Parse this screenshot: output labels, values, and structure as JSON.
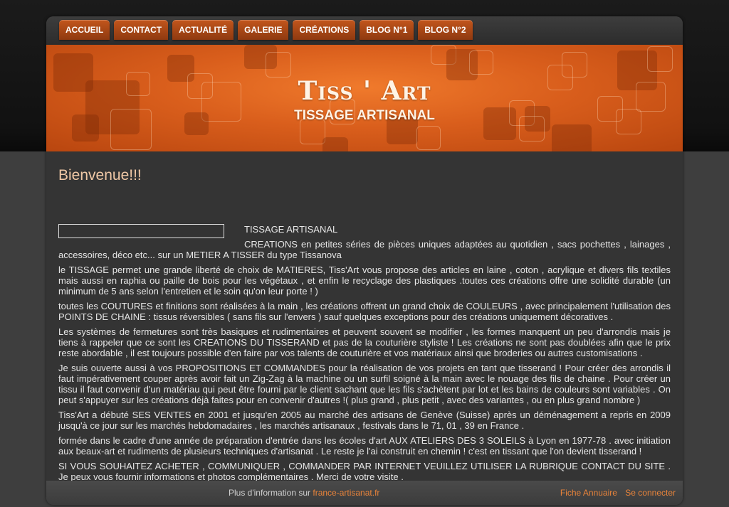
{
  "nav": {
    "items": [
      "ACCUEIL",
      "CONTACT",
      "ACTUALITÉ",
      "GALERIE",
      "CRÉATIONS",
      "BLOG N°1",
      "BLOG N°2"
    ]
  },
  "banner": {
    "title": "Tiss ' Art",
    "subtitle": "TISSAGE ARTISANAL"
  },
  "content": {
    "welcome": "Bienvenue!!!",
    "paragraphs": [
      "TISSAGE ARTISANAL",
      "CREATIONS en petites séries de pièces uniques adaptées au quotidien , sacs pochettes , lainages , accessoires, déco etc... sur un METIER A TISSER du type Tissanova",
      "le TISSAGE permet une grande liberté de choix de MATIERES, Tiss'Art vous propose des articles en laine , coton , acrylique  et divers fils textiles mais aussi en raphia ou paille de bois pour les végétaux , et enfin le recyclage des plastiques .toutes ces créations offre une solidité durable (un minimum de 5 ans selon l'entretien et le soin  qu'on leur porte ! )",
      "toutes les COUTURES et finitions sont réalisées à la main , les créations offrent un grand choix de COULEURS , avec principalement l'utilisation des POINTS DE CHAINE : tissus réversibles ( sans fils sur l'envers ) sauf quelques exceptions pour des créations uniquement décoratives .",
      "Les systèmes de fermetures sont très basiques et rudimentaires et peuvent souvent se modifier , les formes manquent un peu d'arrondis mais je tiens à rappeler que ce sont les CREATIONS DU TISSERAND et pas de la couturière styliste ! Les créations ne sont pas doublées afin que le prix reste abordable , il est toujours possible d'en faire par vos talents de couturière et vos matériaux ainsi que broderies ou autres customisations .",
      "Je suis ouverte aussi à vos PROPOSITIONS ET COMMANDES pour la réalisation de vos projets en tant que tisserand ! Pour créer des arrondis il faut impérativement couper après avoir fait un Zig-Zag à la machine ou un surfil soigné à la main avec le nouage des fils de chaine . Pour créer un tissu il faut convenir d'un matériau qui peut être fourni par le client sachant que les fils s'achètent par lot et les bains de couleurs sont variables . On peut s'appuyer sur les créations déjà faites pour en convenir d'autres !( plus grand , plus petit , avec des variantes , ou en plus grand nombre )",
      "Tiss'Art a débuté SES VENTES en 2001 et jusqu'en 2005 au marché des artisans de Genève (Suisse) après un déménagement a repris en 2009 jusqu'à ce jour sur les marchés hebdomadaires , les marchés artisanaux , festivals dans le 71, 01 , 39 en France .",
      "formée dans le cadre d'une année de préparation d'entrée dans les écoles d'art AUX ATELIERS DES 3 SOLEILS à Lyon en 1977-78 . avec initiation aux beaux-art et rudiments de plusieurs techniques d'artisanat . Le reste je l'ai construit en chemin ! c'est en tissant que l'on devient tisserand !",
      " SI VOUS SOUHAITEZ ACHETER , COMMUNIQUER , COMMANDER PAR INTERNET VEUILLEZ UTILISER LA RUBRIQUE CONTACT DU SITE . Je peux vous fournir informations et photos complémentaires . Merci de votre visite ."
    ]
  },
  "footer": {
    "info_prefix": "Plus d'information sur",
    "info_link": "france-artisanat.fr",
    "link_annuaire": "Fiche Annuaire",
    "link_login": "Se connecter"
  },
  "colors": {
    "accent": "#e8833a",
    "nav_tab": "#b14a16",
    "banner": "#e06a22",
    "background": "#343434"
  }
}
